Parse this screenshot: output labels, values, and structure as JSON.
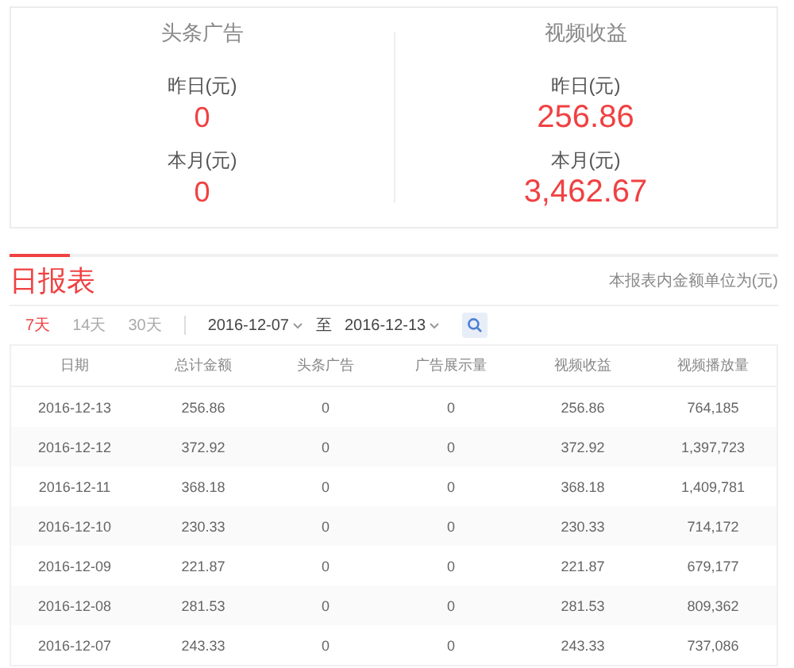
{
  "summary": [
    {
      "title": "头条广告",
      "stats": [
        {
          "label": "昨日(元)",
          "value": "0"
        },
        {
          "label": "本月(元)",
          "value": "0"
        }
      ]
    },
    {
      "title": "视频收益",
      "stats": [
        {
          "label": "昨日(元)",
          "value": "256.86"
        },
        {
          "label": "本月(元)",
          "value": "3,462.67"
        }
      ]
    }
  ],
  "report": {
    "title": "日报表",
    "unit_note": "本报表内金额单位为(元)",
    "ranges": [
      {
        "label": "7天",
        "selected": true
      },
      {
        "label": "14天",
        "selected": false
      },
      {
        "label": "30天",
        "selected": false
      }
    ],
    "start_date": "2016-12-07",
    "separator": "至",
    "end_date": "2016-12-13"
  },
  "table": {
    "columns": [
      "日期",
      "总计金额",
      "头条广告",
      "广告展示量",
      "视频收益",
      "视频播放量"
    ],
    "rows": [
      [
        "2016-12-13",
        "256.86",
        "0",
        "0",
        "256.86",
        "764,185"
      ],
      [
        "2016-12-12",
        "372.92",
        "0",
        "0",
        "372.92",
        "1,397,723"
      ],
      [
        "2016-12-11",
        "368.18",
        "0",
        "0",
        "368.18",
        "1,409,781"
      ],
      [
        "2016-12-10",
        "230.33",
        "0",
        "0",
        "230.33",
        "714,172"
      ],
      [
        "2016-12-09",
        "221.87",
        "0",
        "0",
        "221.87",
        "679,177"
      ],
      [
        "2016-12-08",
        "281.53",
        "0",
        "0",
        "281.53",
        "809,362"
      ],
      [
        "2016-12-07",
        "243.33",
        "0",
        "0",
        "243.33",
        "737,086"
      ]
    ]
  }
}
